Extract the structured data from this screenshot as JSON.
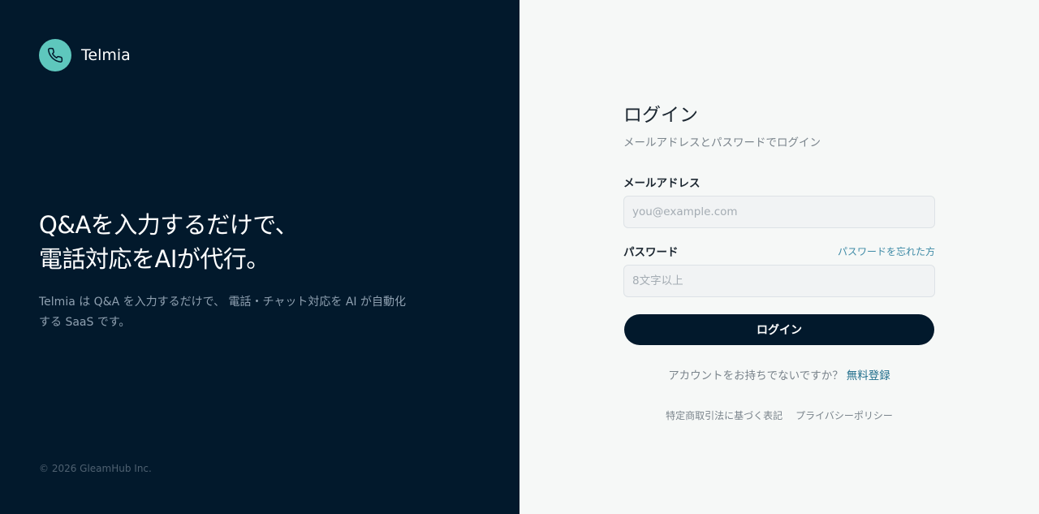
{
  "brand": {
    "name": "Telmia",
    "icon": "phone-icon",
    "color": "#5ec7bd"
  },
  "hero": {
    "title_line1": "Q&Aを入力するだけで、",
    "title_line2": "電話対応をAIが代行。",
    "description": "Telmia は Q&A を入力するだけで、 電話・チャット対応を AI が自動化する SaaS です。"
  },
  "copyright": "© 2026 GleamHub Inc.",
  "login": {
    "title": "ログイン",
    "subtitle": "メールアドレスとパスワードでログイン",
    "email_label": "メールアドレス",
    "email_placeholder": "you@example.com",
    "email_value": "",
    "password_label": "パスワード",
    "forgot_link": "パスワードを忘れた方",
    "password_placeholder": "8文字以上",
    "password_value": "",
    "submit": "ログイン",
    "signup_prompt": "アカウントをお持ちでないですか？",
    "signup_link": "無料登録"
  },
  "footer": {
    "legal": "特定商取引法に基づく表記",
    "privacy": "プライバシーポリシー"
  },
  "colors": {
    "left_bg": "#02192c",
    "right_bg": "#f6f8f7",
    "accent_link": "#1f6d8b",
    "button_bg": "#02192c"
  }
}
